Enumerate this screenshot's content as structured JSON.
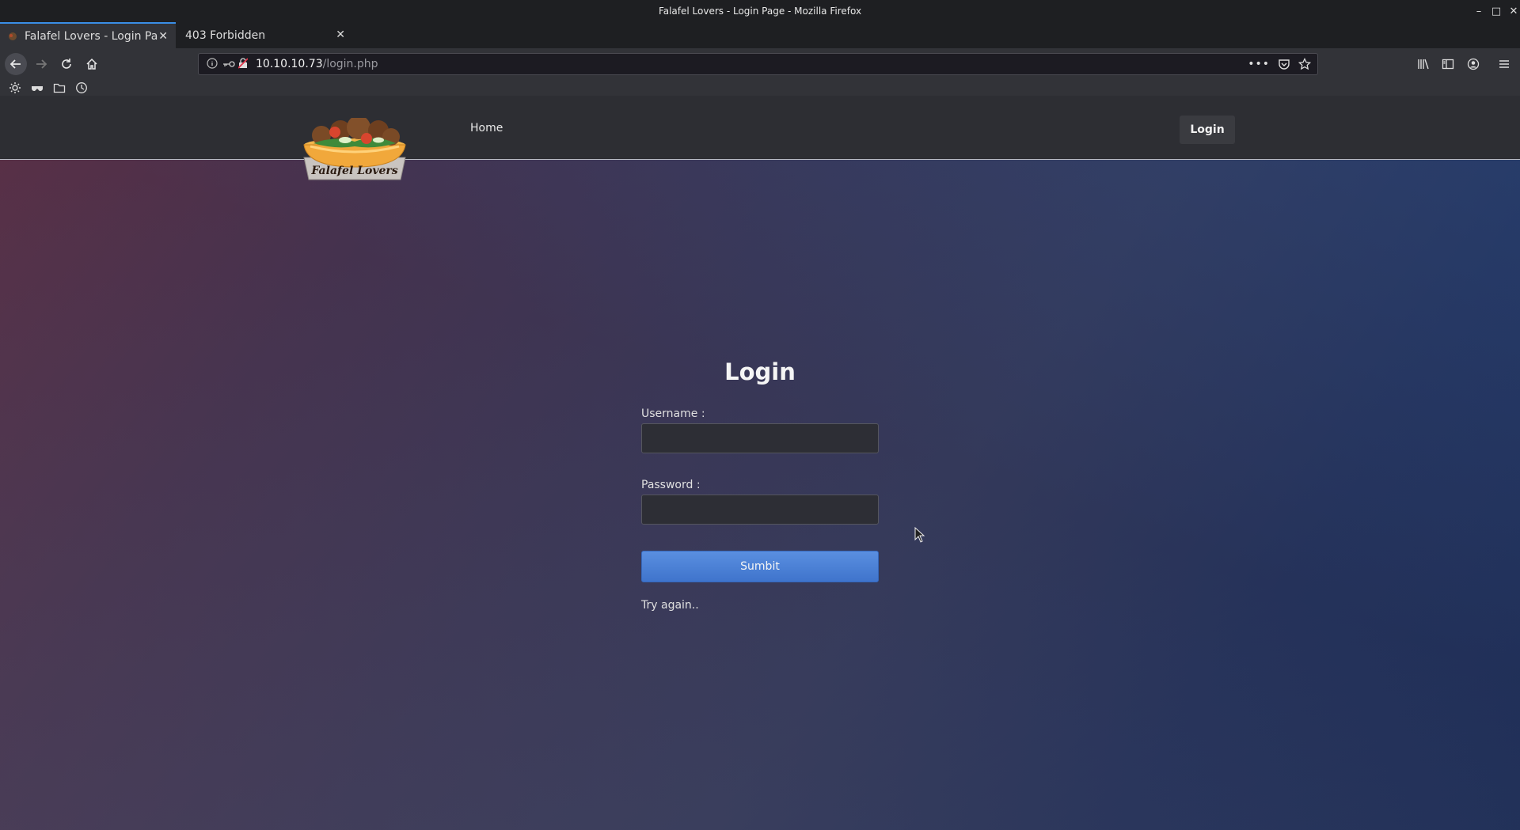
{
  "window": {
    "title": "Falafel Lovers - Login Page - Mozilla Firefox"
  },
  "tabs": [
    {
      "label": "Falafel Lovers - Login Pa",
      "active": true
    },
    {
      "label": "403 Forbidden",
      "active": false
    }
  ],
  "urlbar": {
    "host": "10.10.10.73",
    "path": "/login.php"
  },
  "site": {
    "logo_text": "Falafel Lovers",
    "nav_home": "Home",
    "nav_login": "Login"
  },
  "login": {
    "title": "Login",
    "username_label": "Username :",
    "username_value": "",
    "password_label": "Password :",
    "password_value": "",
    "submit_label": "Sumbit",
    "message": "Try again.."
  },
  "colors": {
    "accent": "#3a8ee6",
    "submit": "#4a7fd6"
  }
}
